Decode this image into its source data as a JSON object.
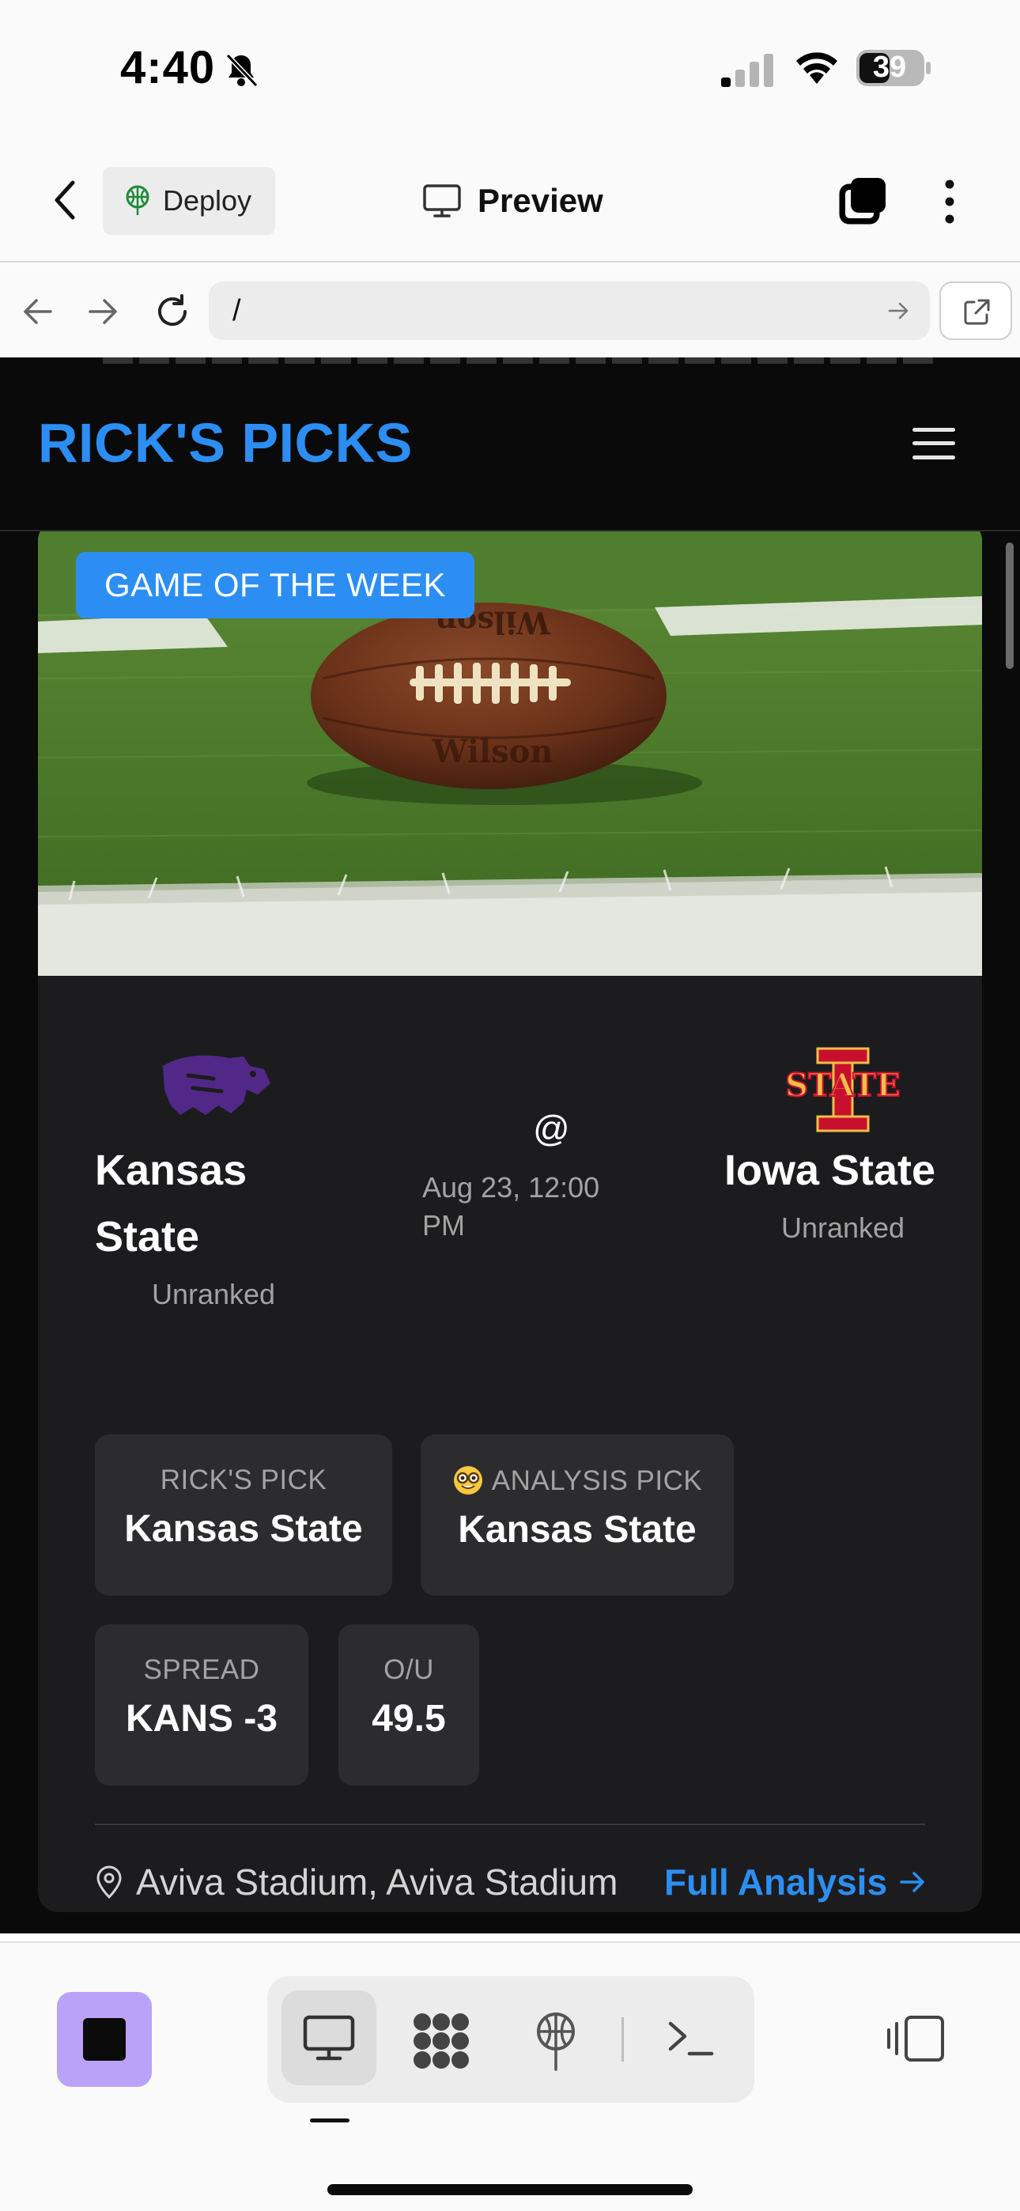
{
  "status_bar": {
    "time": "4:40",
    "battery": "39",
    "icons": [
      "bell-slash-icon",
      "signal-icon",
      "wifi-icon",
      "battery-icon"
    ]
  },
  "app_header": {
    "deploy_label": "Deploy",
    "preview_label": "Preview",
    "icons": [
      "chevron-left-icon",
      "deploy-icon",
      "monitor-icon",
      "tabs-icon",
      "more-vertical-icon"
    ]
  },
  "browser": {
    "url": "/",
    "icons": [
      "arrow-left-icon",
      "arrow-right-icon",
      "reload-icon",
      "go-arrow-icon",
      "open-external-icon"
    ]
  },
  "site": {
    "brand": "RICK'S PICKS",
    "menu_icon": "hamburger-menu-icon"
  },
  "game": {
    "badge": "GAME OF THE WEEK",
    "home_team": {
      "name": "Kansas State",
      "rank": "Unranked",
      "color": "#512888"
    },
    "away_team": {
      "name": "Iowa State",
      "rank": "Unranked",
      "color": "#c8102e",
      "accent": "#f1be48"
    },
    "at": "@",
    "date": "Aug 23, 12:00 PM",
    "ricks_pick_label": "RICK'S PICK",
    "ricks_pick_value": "Kansas State",
    "analysis_pick_label": "ANALYSIS PICK",
    "analysis_pick_value": "Kansas State",
    "analysis_emoji": "nerd-face-icon",
    "spread_label": "SPREAD",
    "spread_value": "KANS -3",
    "ou_label": "O/U",
    "ou_value": "49.5",
    "venue": "Aviva Stadium, Aviva Stadium",
    "full_analysis_label": "Full Analysis"
  },
  "bottom_bar": {
    "icons": [
      "stop-icon",
      "monitor-icon",
      "apps-icon",
      "deploy-icon",
      "terminal-icon",
      "layout-panels-icon"
    ]
  },
  "colors": {
    "accent": "#2c8ef2",
    "site_bg": "#0a0a0b",
    "card_bg": "#1c1c1e",
    "stop_button": "#b9a2f7"
  }
}
